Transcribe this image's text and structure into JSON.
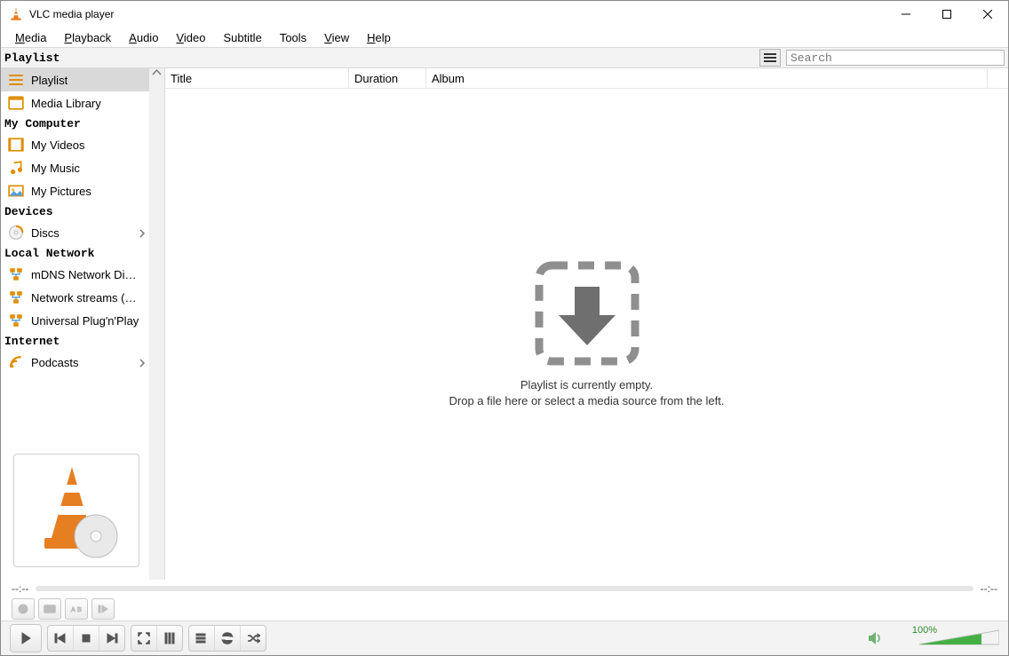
{
  "window": {
    "title": "VLC media player"
  },
  "menu": {
    "media": {
      "u": "M",
      "rest": "edia"
    },
    "playback": {
      "u": "P",
      "rest": "layback"
    },
    "audio": {
      "u": "A",
      "rest": "udio"
    },
    "video": {
      "u": "V",
      "rest": "ideo"
    },
    "subtitle": {
      "u": "S",
      "rest": "ubtitle"
    },
    "tools": {
      "u": "T",
      "rest": "ools"
    },
    "view": {
      "u": "V",
      "rest": "iew"
    },
    "help": {
      "u": "H",
      "rest": "elp"
    }
  },
  "strip": {
    "title": "Playlist",
    "search_placeholder": "Search"
  },
  "sidebar": {
    "playlist_head": "Playlist",
    "playlist": "Playlist",
    "media_library": "Media Library",
    "computer_head": "My Computer",
    "my_videos": "My Videos",
    "my_music": "My Music",
    "my_pictures": "My Pictures",
    "devices_head": "Devices",
    "discs": "Discs",
    "localnet_head": "Local Network",
    "mdns": "mDNS Network Disco...",
    "sap": "Network streams (SAP)",
    "upnp": "Universal Plug'n'Play",
    "internet_head": "Internet",
    "podcasts": "Podcasts"
  },
  "columns": {
    "title": "Title",
    "duration": "Duration",
    "album": "Album"
  },
  "drop": {
    "line1": "Playlist is currently empty.",
    "line2": "Drop a file here or select a media source from the left."
  },
  "time": {
    "left": "--:--",
    "right": "--:--"
  },
  "volume": {
    "pct": "100%"
  }
}
